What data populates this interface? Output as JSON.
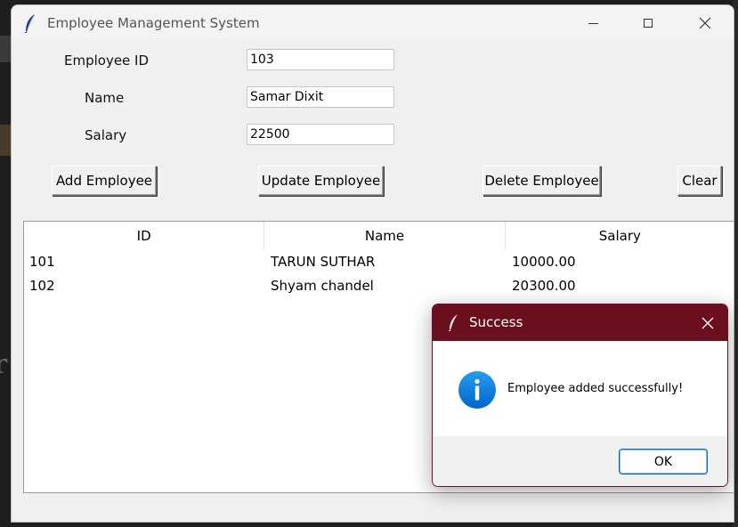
{
  "window": {
    "title": "Employee Management System"
  },
  "form": {
    "employee_id_label": "Employee ID",
    "employee_id_value": "103",
    "name_label": "Name",
    "name_value": "Samar Dixit",
    "salary_label": "Salary",
    "salary_value": "22500"
  },
  "buttons": {
    "add": "Add Employee",
    "update": "Update Employee",
    "delete": "Delete Employee",
    "clear": "Clear"
  },
  "table": {
    "columns": [
      "ID",
      "Name",
      "Salary"
    ],
    "rows": [
      [
        "101",
        "TARUN SUTHAR",
        "10000.00"
      ],
      [
        "102",
        "Shyam chandel",
        "20300.00"
      ]
    ]
  },
  "dialog": {
    "title": "Success",
    "message": "Employee added successfully!",
    "ok_label": "OK"
  },
  "icons": {
    "app": "feather-icon",
    "info": "info-icon"
  },
  "colors": {
    "dialog_titlebar": "#6b0f1f",
    "info_blue": "#0a78d6",
    "ok_border": "#0067c0"
  }
}
